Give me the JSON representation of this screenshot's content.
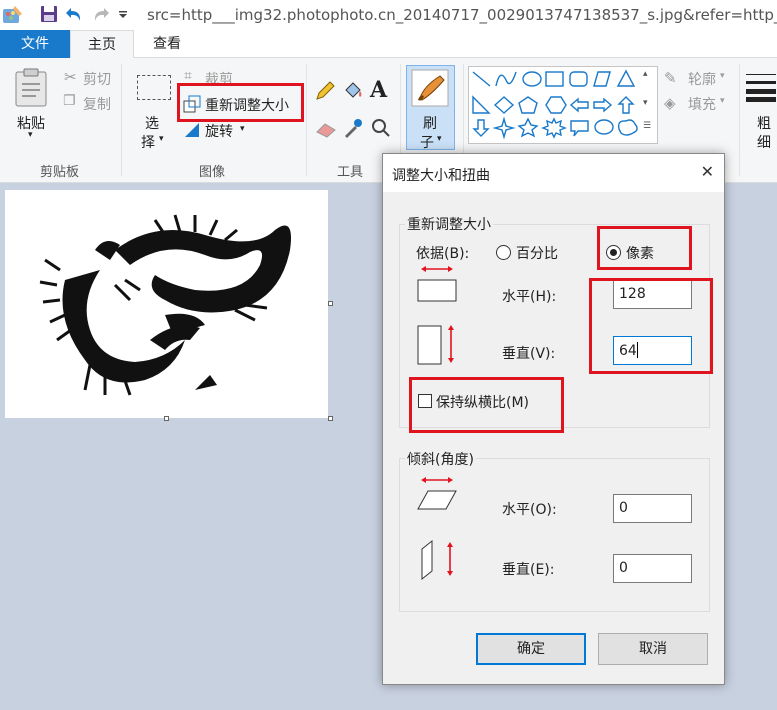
{
  "window": {
    "title": "src=http___img32.photophoto.cn_20140717_0029013747138537_s.jpg&refer=http___i"
  },
  "tabs": {
    "file": "文件",
    "home": "主页",
    "view": "查看"
  },
  "ribbon": {
    "clipboard": {
      "paste": "粘贴",
      "cut": "剪切",
      "copy": "复制",
      "group": "剪贴板"
    },
    "image": {
      "select_line1": "选",
      "select_line2": "择",
      "crop": "裁剪",
      "resize": "重新调整大小",
      "rotate": "旋转",
      "group": "图像"
    },
    "tools": {
      "group": "工具"
    },
    "brush": {
      "line1": "刷",
      "line2": "子"
    },
    "shapes": {
      "outline": "轮廓",
      "fill": "填充"
    },
    "size": {
      "line1": "粗",
      "line2": "细"
    }
  },
  "dialog": {
    "title": "调整大小和扭曲",
    "resize_group": "重新调整大小",
    "by_label": "依据(B):",
    "percent_option": "百分比",
    "pixels_option": "像素",
    "selected_unit": "pixels",
    "horizontal_label": "水平(H):",
    "horizontal_value": "128",
    "vertical_label": "垂直(V):",
    "vertical_value": "64",
    "keep_ratio_label": "保持纵横比(M)",
    "keep_ratio_checked": false,
    "skew_group": "倾斜(角度)",
    "skew_h_label": "水平(O):",
    "skew_h_value": "0",
    "skew_v_label": "垂直(E):",
    "skew_v_value": "0",
    "ok": "确定",
    "cancel": "取消"
  },
  "colors": {
    "accent": "#1979ca",
    "highlight": "#e0141e"
  }
}
